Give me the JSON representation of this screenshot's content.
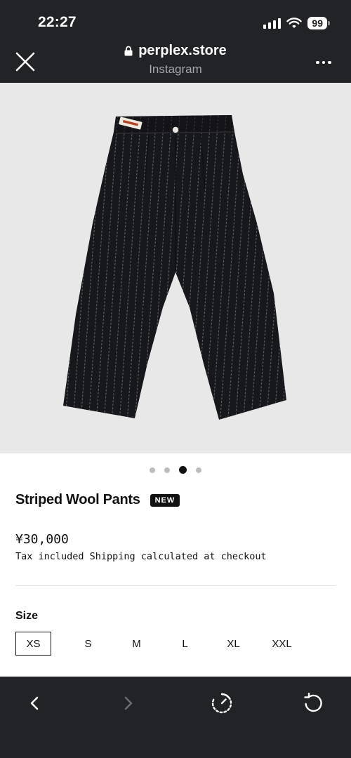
{
  "status_bar": {
    "time": "22:27",
    "battery": "99",
    "icons": [
      "signal-icon",
      "wifi-icon",
      "battery-icon"
    ]
  },
  "browser": {
    "domain": "perplex.store",
    "source": "Instagram",
    "icons": [
      "close-icon",
      "lock-icon",
      "more-icon"
    ]
  },
  "carousel": {
    "total": 4,
    "active_index": 2
  },
  "product": {
    "title": "Striped Wool Pants",
    "badge": "NEW",
    "price": "¥30,000",
    "tax_note": "Tax included Shipping calculated at checkout",
    "image_label": "pants-product-photo"
  },
  "size": {
    "label": "Size",
    "options": [
      "XS",
      "S",
      "M",
      "L",
      "XL",
      "XXL"
    ],
    "selected": "XS"
  },
  "toolbar": {
    "icons": [
      "back-icon",
      "forward-icon",
      "speed-icon",
      "reload-icon"
    ]
  },
  "colors": {
    "chrome": "#222326",
    "image_bg": "#e8e8e8",
    "fabric": "#17181b",
    "stripe": "#5b5d63",
    "text": "#111111"
  }
}
